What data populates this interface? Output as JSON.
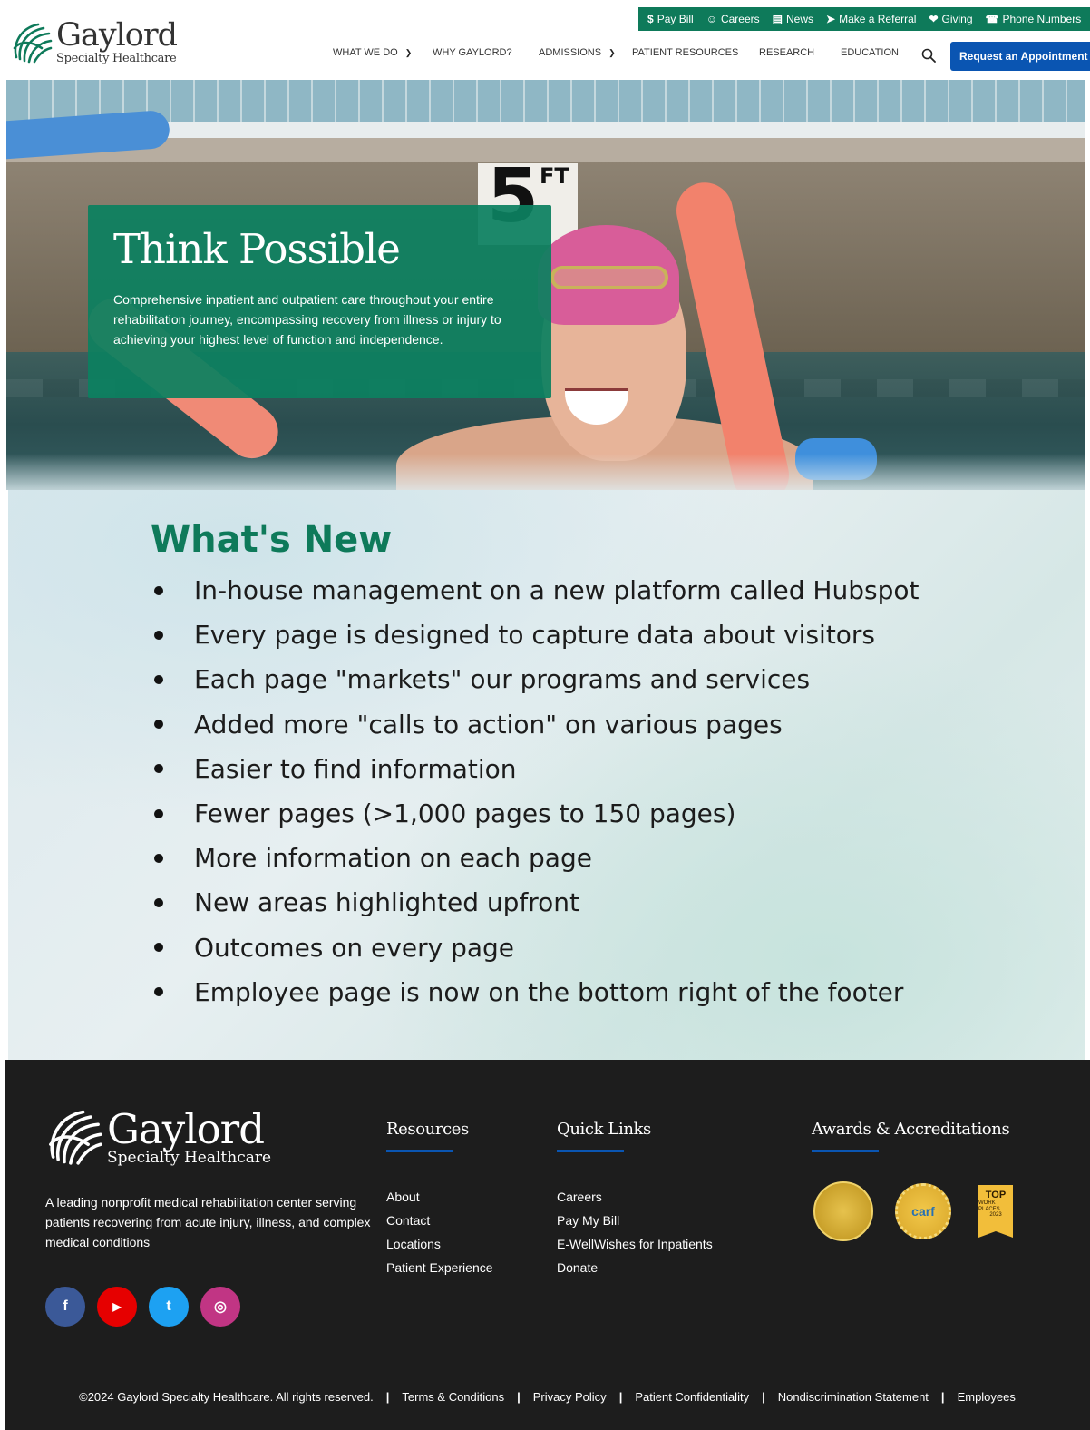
{
  "brand": {
    "name": "Gaylord",
    "sub": "Specialty Healthcare"
  },
  "utility_nav": [
    {
      "icon": "$",
      "label": "Pay Bill"
    },
    {
      "icon": "☺",
      "label": "Careers"
    },
    {
      "icon": "▤",
      "label": "News"
    },
    {
      "icon": "➤",
      "label": "Make a Referral"
    },
    {
      "icon": "❤",
      "label": "Giving"
    },
    {
      "icon": "☎",
      "label": "Phone Numbers"
    }
  ],
  "main_nav": [
    {
      "label": "WHAT WE DO",
      "has_dropdown": true
    },
    {
      "label": "WHY GAYLORD?",
      "has_dropdown": false
    },
    {
      "label": "ADMISSIONS",
      "has_dropdown": true
    },
    {
      "label": "PATIENT RESOURCES",
      "has_dropdown": false
    },
    {
      "label": "RESEARCH",
      "has_dropdown": false
    },
    {
      "label": "EDUCATION",
      "has_dropdown": false
    }
  ],
  "cta_label": "Request an Appointment",
  "hero": {
    "title": "Think Possible",
    "description": "Comprehensive inpatient and outpatient care throughout your entire rehabilitation journey, encompassing recovery from illness or injury to achieving your highest level of function and independence.",
    "sign_number": "5",
    "sign_unit": "FT"
  },
  "whats_new": {
    "title": "What's New",
    "items": [
      "In-house management on a new platform called Hubspot",
      "Every page is designed to capture data about visitors",
      "Each page \"markets\" our programs and services",
      "Added more \"calls to action\" on various pages",
      "Easier to find information",
      "Fewer pages (>1,000 pages to 150 pages)",
      "More information on each page",
      "New areas highlighted upfront",
      "Outcomes on every page",
      "Employee page is now on the bottom right of the footer"
    ]
  },
  "footer": {
    "tagline": "A leading nonprofit medical rehabilitation center serving patients recovering from acute injury, illness, and complex medical conditions",
    "social": [
      {
        "name": "facebook",
        "glyph": "f",
        "color": "#3b5998"
      },
      {
        "name": "youtube",
        "glyph": "▶",
        "color": "#e60000"
      },
      {
        "name": "twitter",
        "glyph": "t",
        "color": "#1da1f2"
      },
      {
        "name": "instagram",
        "glyph": "◎",
        "color": "#c13584"
      }
    ],
    "resources": {
      "title": "Resources",
      "links": [
        "About",
        "Contact",
        "Locations",
        "Patient Experience"
      ]
    },
    "quick_links": {
      "title": "Quick Links",
      "links": [
        "Careers",
        "Pay My Bill",
        "E-WellWishes for Inpatients",
        "Donate"
      ]
    },
    "awards": {
      "title": "Awards & Accreditations",
      "carf_label": "carf",
      "top_label": "TOP",
      "top_sub": "WORK PLACES",
      "top_year": "2023"
    },
    "copyright": "©2024 Gaylord Specialty Healthcare. All rights reserved.",
    "legal_links": [
      "Terms & Conditions",
      "Privacy Policy",
      "Patient Confidentiality",
      "Nondiscrimination Statement",
      "Employees"
    ]
  },
  "colors": {
    "brand_green": "#0e7a5a",
    "brand_blue": "#0a55b2",
    "footer_bg": "#1d1d1d"
  }
}
